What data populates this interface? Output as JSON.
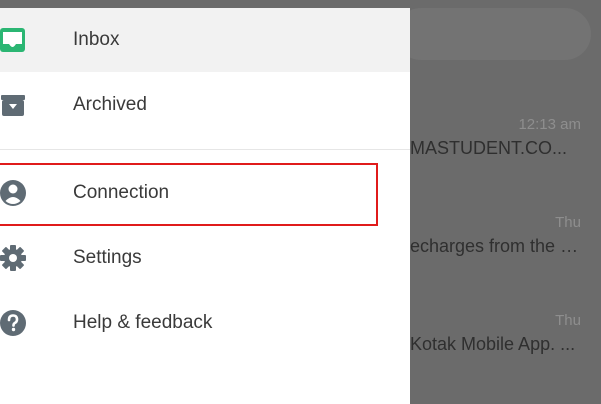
{
  "drawer": {
    "items": [
      {
        "label": "Inbox",
        "icon": "inbox-icon"
      },
      {
        "label": "Archived",
        "icon": "archive-icon"
      },
      {
        "label": "Connection",
        "icon": "account-icon"
      },
      {
        "label": "Settings",
        "icon": "gear-icon"
      },
      {
        "label": "Help & feedback",
        "icon": "help-icon"
      }
    ]
  },
  "email_list": {
    "items": [
      {
        "time": "12:13 am",
        "subject": "MASTUDENT.CO..."
      },
      {
        "time": "Thu",
        "subject": "echarges from the c..."
      },
      {
        "time": "Thu",
        "subject": "Kotak Mobile App. ..."
      }
    ]
  },
  "colors": {
    "inbox_accent": "#2bb673",
    "icon_grey": "#5f6b74",
    "highlight": "#e01b1b",
    "overlay": "#6b6b6b"
  }
}
